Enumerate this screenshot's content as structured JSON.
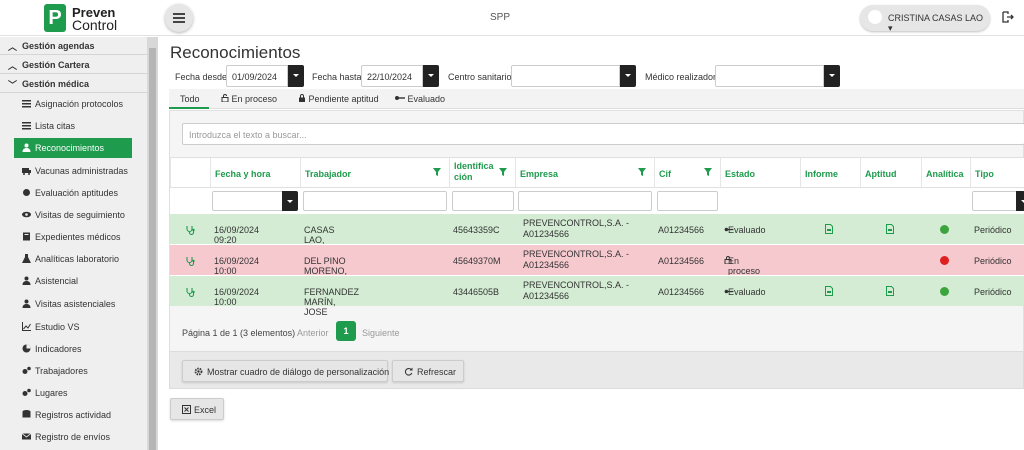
{
  "app": {
    "logo_line1": "Preven",
    "logo_line2": "Control",
    "title": "SPP",
    "user_name": "CRISTINA CASAS LAO"
  },
  "sidebar": {
    "sections": [
      {
        "label": "Gestión agendas",
        "expanded": true
      },
      {
        "label": "Gestión Cartera",
        "expanded": false
      },
      {
        "label": "Gestión médica",
        "expanded": true
      }
    ],
    "items": [
      {
        "label": "Asignación protocolos",
        "icon": "list-icon"
      },
      {
        "label": "Lista citas",
        "icon": "list-icon"
      },
      {
        "label": "Reconocimientos",
        "icon": "user-md-icon",
        "active": true
      },
      {
        "label": "Vacunas administradas",
        "icon": "ambulance-icon"
      },
      {
        "label": "Evaluación aptitudes",
        "icon": "circle-icon"
      },
      {
        "label": "Visitas de seguimiento",
        "icon": "eye-icon"
      },
      {
        "label": "Expedientes médicos",
        "icon": "book-icon"
      },
      {
        "label": "Analíticas laboratorio",
        "icon": "flask-icon"
      },
      {
        "label": "Asistencial",
        "icon": "user-md-icon"
      },
      {
        "label": "Visitas asistenciales",
        "icon": "user-md-icon"
      },
      {
        "label": "Estudio VS",
        "icon": "chart-icon"
      },
      {
        "label": "Indicadores",
        "icon": "pie-icon"
      },
      {
        "label": "Trabajadores",
        "icon": "cogs-icon"
      },
      {
        "label": "Lugares",
        "icon": "cogs-icon"
      },
      {
        "label": "Registros actividad",
        "icon": "database-icon"
      },
      {
        "label": "Registro de envíos",
        "icon": "envelope-icon"
      }
    ]
  },
  "main": {
    "title": "Reconocimientos",
    "filters": {
      "fecha_desde_label": "Fecha desde",
      "fecha_desde": "01/09/2024",
      "fecha_hasta_label": "Fecha hasta",
      "fecha_hasta": "22/10/2024",
      "centro_label": "Centro sanitario",
      "centro": "",
      "medico_label": "Médico realizador",
      "medico": ""
    },
    "tabs": [
      "Todo",
      "En proceso",
      "Pendiente aptitud",
      "Evaluado"
    ],
    "search_placeholder": "Introduzca el texto a buscar...",
    "columns": {
      "fecha": "Fecha y hora",
      "trabajador": "Trabajador",
      "ident1": "Identifica",
      "ident2": "ción",
      "empresa": "Empresa",
      "cif": "Cif",
      "estado": "Estado",
      "informe": "Informe",
      "aptitud": "Aptitud",
      "analitica": "Analítica",
      "tipo": "Tipo"
    },
    "rows": [
      {
        "status": "ok",
        "fecha": "16/09/2024 09:20",
        "trabajador": "CASAS LAO, CRISTINA",
        "id": "45643359C",
        "empresa1": "PREVENCONTROL,S.A. -",
        "empresa2": "A01234566",
        "cif": "A01234566",
        "estado": "Evaluado",
        "informe": true,
        "aptitud": true,
        "analitica_color": "#3ca43c",
        "tipo": "Periódico"
      },
      {
        "status": "pend",
        "fecha": "16/09/2024 10:00",
        "trabajador": "DEL PINO MORENO, MONICA",
        "id": "45649370M",
        "empresa1": "PREVENCONTROL,S.A. -",
        "empresa2": "A01234566",
        "cif": "A01234566",
        "estado": "En proceso",
        "informe": false,
        "aptitud": false,
        "analitica_color": "#e02020",
        "tipo": "Periódico"
      },
      {
        "status": "ok",
        "fecha": "16/09/2024 10:00",
        "trabajador": "FERNANDEZ MARÍN, JOSE",
        "id": "43446505B",
        "empresa1": "PREVENCONTROL,S.A. -",
        "empresa2": "A01234566",
        "cif": "A01234566",
        "estado": "Evaluado",
        "informe": true,
        "aptitud": true,
        "analitica_color": "#3ca43c",
        "tipo": "Periódico"
      }
    ],
    "pager": {
      "text": "Página 1 de 1 (3 elementos)",
      "prev": "Anterior",
      "current": "1",
      "next": "Siguiente"
    },
    "buttons": {
      "customize": "Mostrar cuadro de diálogo de personalización",
      "refresh": "Refrescar",
      "excel": "Excel"
    }
  }
}
